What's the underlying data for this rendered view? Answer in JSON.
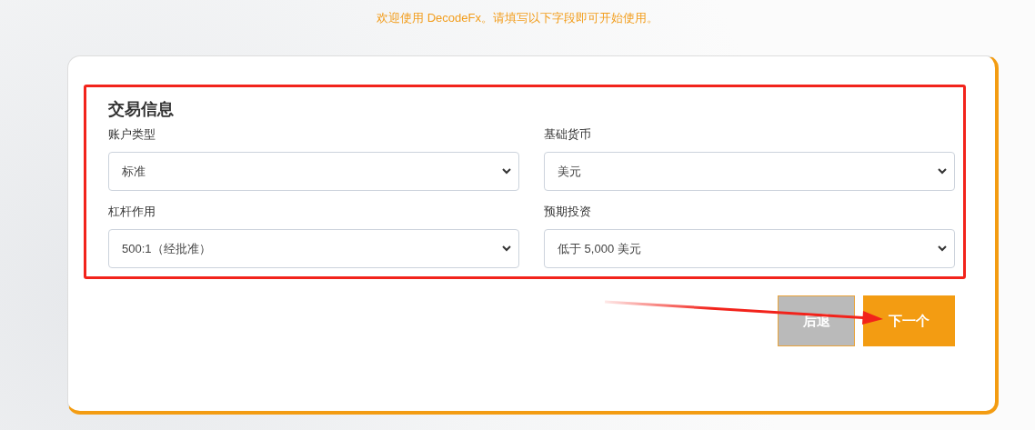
{
  "intro": "欢迎使用 DecodeFx。请填写以下字段即可开始使用。",
  "section": {
    "title": "交易信息",
    "fields": [
      {
        "label": "账户类型",
        "value": "标准"
      },
      {
        "label": "基础货币",
        "value": "美元"
      },
      {
        "label": "杠杆作用",
        "value": "500:1（经批准）"
      },
      {
        "label": "预期投资",
        "value": "低于 5,000 美元"
      }
    ]
  },
  "buttons": [
    {
      "label": "后退",
      "kind": "secondary"
    },
    {
      "label": "下一个",
      "kind": "primary"
    }
  ]
}
